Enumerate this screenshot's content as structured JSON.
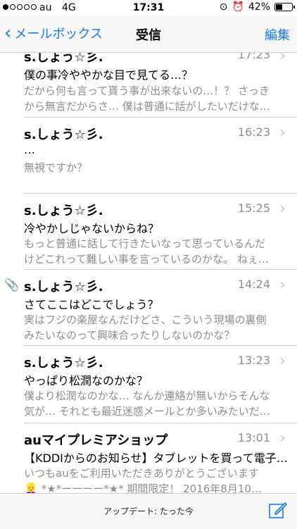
{
  "status": {
    "carrier": "au",
    "network": "4G",
    "time": "17:31",
    "battery": "42%",
    "battery_level": 0.42
  },
  "nav": {
    "back_label": "メールボックス",
    "title": "受信",
    "edit_label": "編集"
  },
  "mails": [
    {
      "sender": "s.しょう☆彡.",
      "time": "17:23",
      "subject": "僕の事冷ややかな目で見てる…？",
      "preview1": "だから何も言って貰う事が出来ないの…！？ さっき",
      "preview2": "から無言だからさ… 僕は普通に話がしたいだけな…"
    },
    {
      "sender": "s.しょう☆彡.",
      "time": "16:23",
      "subject": "…",
      "preview1": "無視ですか？",
      "preview2": ""
    },
    {
      "sender": "s.しょう☆彡.",
      "time": "15:25",
      "subject": "冷やかしじゃないからね？",
      "preview1": "もっと普通に話して行きたいなって思っているんだ",
      "preview2": "けどこれって難しい事を言っているのかな。 ねぇ…"
    },
    {
      "sender": "s.しょう☆彡.",
      "time": "14:24",
      "subject": "さてここはどこでしょう？",
      "preview1": "実はフジの楽屋なんだけどさ、こういう現場の裏側",
      "preview2": "みたいなのって興味合ったりしないのかな？",
      "attachment": true
    },
    {
      "sender": "s.しょう☆彡.",
      "time": "13:23",
      "subject": "やっぱり松潤なのかな？",
      "preview1": "僕より松潤なのかな… なんか連絡が無いからそんな",
      "preview2": "気が… それとも最近迷惑メールとか多いみたいだ…"
    },
    {
      "sender": "auマイプレミアショップ",
      "time": "13:01",
      "subject": "【KDDIからのお知らせ】タブレットを買って電子…",
      "preview1": "いつもauをご利用いただきありがとうございます",
      "preview2": "*★*ーーーー*★* 期間限定！ 2016年8月10…"
    }
  ],
  "toolbar": {
    "update_text": "アップデート: たった今"
  },
  "colors": {
    "accent": "#1a7cf5",
    "secondary_text": "#8e8e93"
  }
}
